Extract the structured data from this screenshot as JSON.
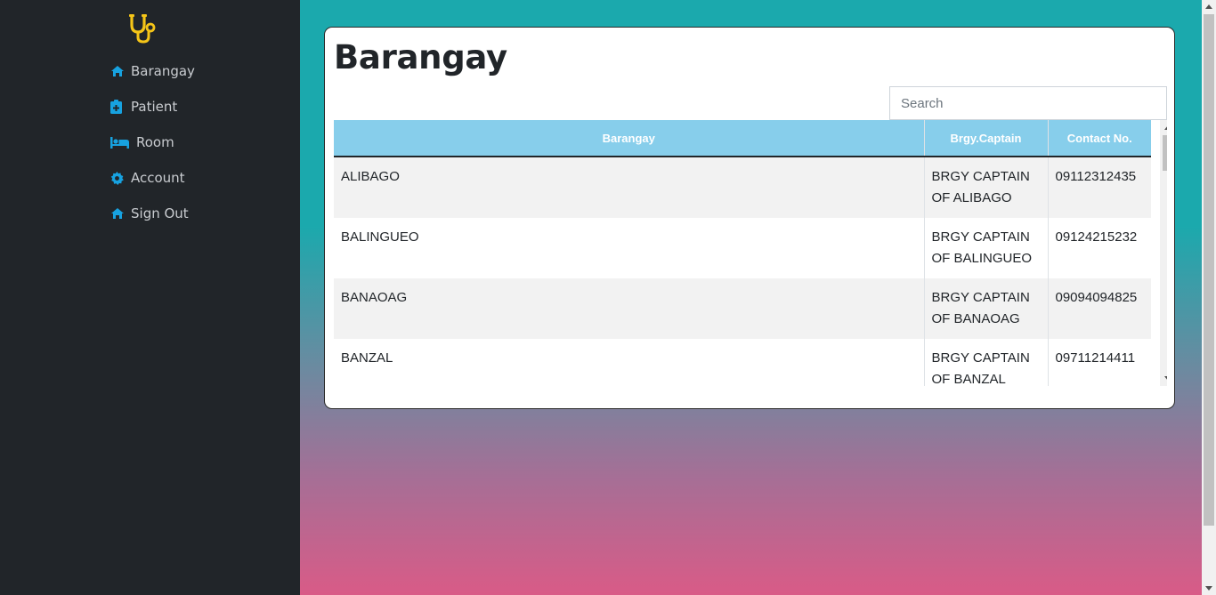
{
  "sidebar": {
    "logo_icon": "stethoscope-icon",
    "logo_color": "#f5c518",
    "icon_color": "#17a2e0",
    "items": [
      {
        "label": "Barangay",
        "icon": "home-icon"
      },
      {
        "label": "Patient",
        "icon": "clipboard-plus-icon"
      },
      {
        "label": "Room",
        "icon": "bed-icon"
      },
      {
        "label": "Account",
        "icon": "gear-icon"
      },
      {
        "label": "Sign Out",
        "icon": "home-icon"
      }
    ]
  },
  "main": {
    "title": "Barangay",
    "search": {
      "placeholder": "Search",
      "value": ""
    },
    "table": {
      "headers": [
        "Barangay",
        "Brgy.Captain",
        "Contact No."
      ],
      "rows": [
        {
          "barangay": "ALIBAGO",
          "captain": "BRGY CAPTAIN OF ALIBAGO",
          "contact": "09112312435"
        },
        {
          "barangay": "BALINGUEO",
          "captain": "BRGY CAPTAIN OF BALINGUEO",
          "contact": "09124215232"
        },
        {
          "barangay": "BANAOAG",
          "captain": "BRGY CAPTAIN OF BANAOAG",
          "contact": "09094094825"
        },
        {
          "barangay": "BANZAL",
          "captain": "BRGY CAPTAIN OF BANZAL",
          "contact": "09711214411"
        }
      ]
    }
  },
  "colors": {
    "sidebar_bg": "#212529",
    "header_bg": "#87ceeb",
    "gradient_top": "#1ba9ad",
    "gradient_bottom": "#d95b87"
  }
}
